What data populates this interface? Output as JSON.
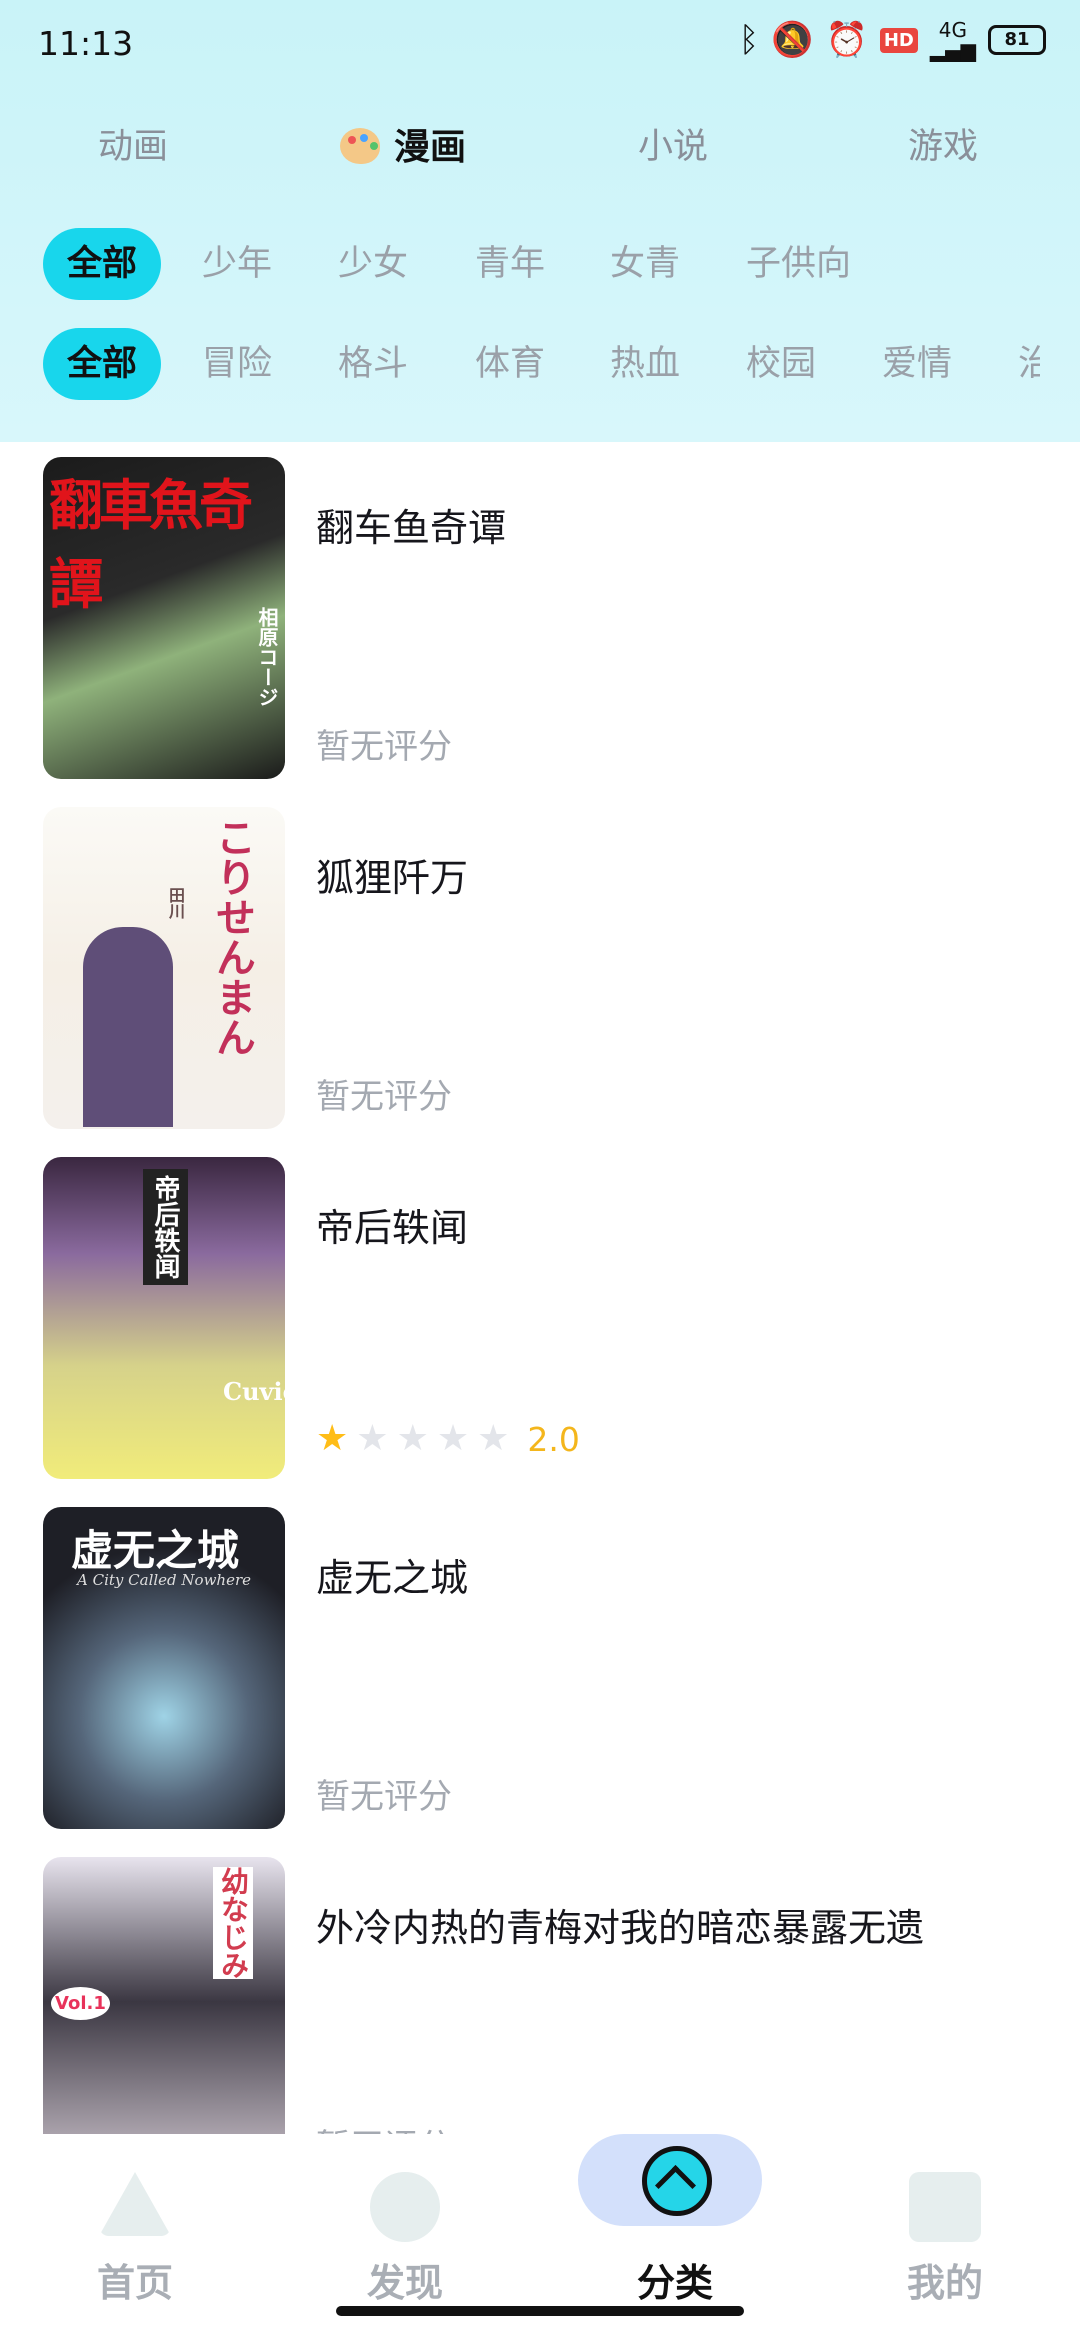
{
  "status_bar": {
    "time": "11:13",
    "icons": [
      "bluetooth-icon",
      "mute-icon",
      "alarm-icon",
      "hd-icon",
      "signal-icon"
    ],
    "hd_label": "HD",
    "network_label": "4G",
    "battery_level": "81"
  },
  "main_tabs": [
    {
      "label": "动画",
      "active": false
    },
    {
      "label": "漫画",
      "active": true
    },
    {
      "label": "小说",
      "active": false
    },
    {
      "label": "游戏",
      "active": false
    }
  ],
  "audience_chips": [
    {
      "label": "全部",
      "active": true
    },
    {
      "label": "少年",
      "active": false
    },
    {
      "label": "少女",
      "active": false
    },
    {
      "label": "青年",
      "active": false
    },
    {
      "label": "女青",
      "active": false
    },
    {
      "label": "子供向",
      "active": false
    }
  ],
  "genre_chips": [
    {
      "label": "全部",
      "active": true
    },
    {
      "label": "冒险",
      "active": false
    },
    {
      "label": "格斗",
      "active": false
    },
    {
      "label": "体育",
      "active": false
    },
    {
      "label": "热血",
      "active": false
    },
    {
      "label": "校园",
      "active": false
    },
    {
      "label": "爱情",
      "active": false
    },
    {
      "label": "治",
      "active": false
    }
  ],
  "comics": [
    {
      "title": "翻车鱼奇谭",
      "rating_text": "暂无评分",
      "rating": null,
      "cover_text": "翻車魚奇譚",
      "cover_sub": "相原コージ"
    },
    {
      "title": "狐狸阡万",
      "rating_text": "暂无评分",
      "rating": null,
      "cover_text": "こりせんまん",
      "cover_sub": "田川"
    },
    {
      "title": "帝后轶闻",
      "rating_text": "",
      "rating": 2.0,
      "rating_stars_filled": 1,
      "score_label": "2.0",
      "cover_text": "帝后轶闻",
      "cover_sub": "Cuvie"
    },
    {
      "title": "虚无之城",
      "rating_text": "暂无评分",
      "rating": null,
      "cover_text": "虚无之城",
      "cover_sub": "A City Called Nowhere"
    },
    {
      "title": "外冷内热的青梅对我的暗恋暴露无遗",
      "rating_text": "暂无评分",
      "rating": null,
      "cover_text": "幼なじみ",
      "cover_sub": "Vol.1"
    }
  ],
  "bottom_nav": [
    {
      "label": "首页",
      "icon": "home-icon",
      "active": false
    },
    {
      "label": "发现",
      "icon": "discover-icon",
      "active": false
    },
    {
      "label": "分类",
      "icon": "category-icon",
      "active": true
    },
    {
      "label": "我的",
      "icon": "profile-icon",
      "active": false
    }
  ],
  "colors": {
    "accent": "#18d6ec",
    "header_bg": "#cdf4f9",
    "star": "#ffbd17",
    "nav_active_bg": "#d3e0fb"
  }
}
